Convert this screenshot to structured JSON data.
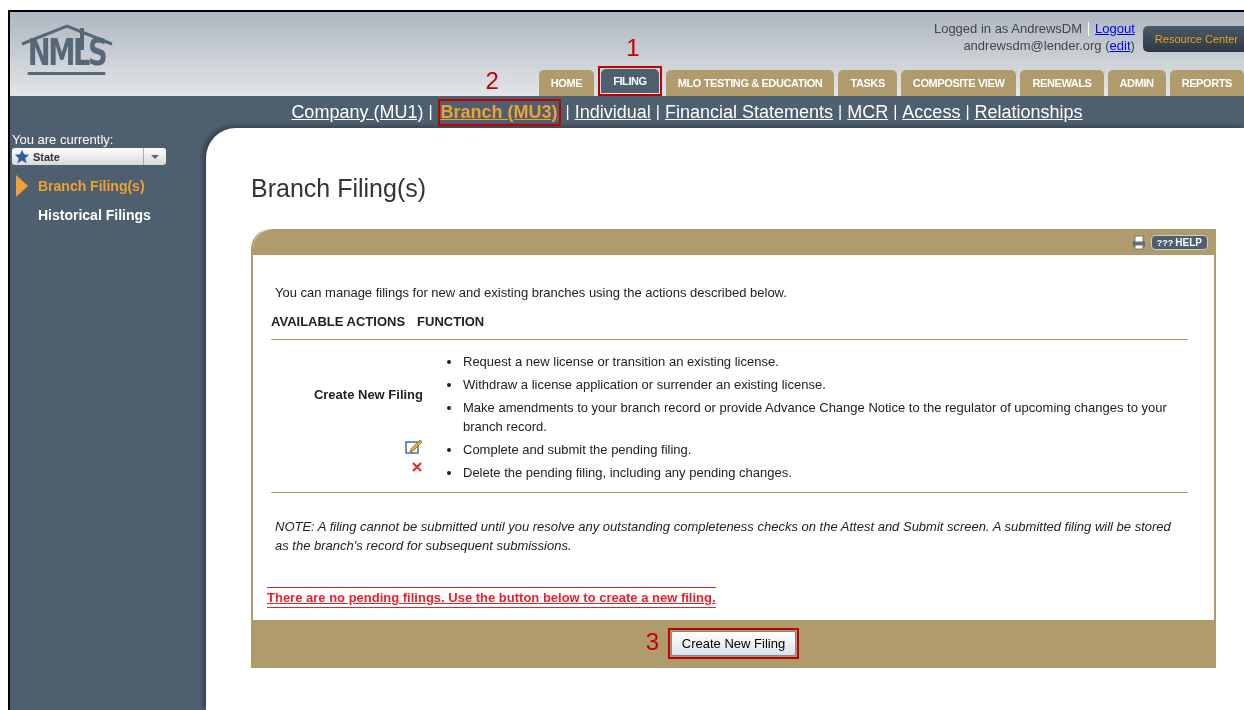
{
  "header": {
    "logo": {
      "text": "NMLS"
    },
    "user": {
      "logged_in": "Logged in as AndrewsDM",
      "logout": "Logout",
      "email_prefix": "andrewsdm@lender.org (",
      "edit": "edit",
      "email_suffix": ")"
    },
    "resource_button": "Resource Center",
    "tabs": [
      {
        "label": "HOME",
        "selected": false
      },
      {
        "label": "FILING",
        "selected": true,
        "callout": "1"
      },
      {
        "label": "MLO TESTING & EDUCATION",
        "selected": false
      },
      {
        "label": "TASKS",
        "selected": false
      },
      {
        "label": "COMPOSITE VIEW",
        "selected": false
      },
      {
        "label": "RENEWALS",
        "selected": false
      },
      {
        "label": "ADMIN",
        "selected": false
      },
      {
        "label": "REPORTS",
        "selected": false
      }
    ]
  },
  "subnav": {
    "links": [
      {
        "label": "Company (MU1)",
        "selected": false
      },
      {
        "label": "Branch (MU3)",
        "selected": true,
        "callout": "2"
      },
      {
        "label": "Individual",
        "selected": false
      },
      {
        "label": "Financial Statements",
        "selected": false
      },
      {
        "label": "MCR",
        "selected": false
      },
      {
        "label": "Access",
        "selected": false
      },
      {
        "label": "Relationships",
        "selected": false
      }
    ],
    "separators": [
      "|",
      "|",
      "|",
      "|",
      "|",
      "|"
    ]
  },
  "sidebar": {
    "context_label": "You are currently:",
    "context_select": "State",
    "items": [
      {
        "label": "Branch Filing(s)",
        "selected": true
      },
      {
        "label": "Historical Filings",
        "selected": false
      }
    ]
  },
  "page_title": "Branch Filing(s)",
  "panel": {
    "help_button": {
      "glyph": "???",
      "label": "HELP"
    },
    "intro": "You can manage filings for new and existing branches using the actions described below.",
    "columns": [
      "AVAILABLE ACTIONS",
      "FUNCTION"
    ],
    "rows": [
      {
        "kind": "text",
        "action": "Create New Filing",
        "functions": [
          "Request a new license or transition an existing license.",
          "Withdraw a license application or surrender an existing license.",
          "Make amendments to your branch record or provide Advance Change Notice to the regulator of upcoming changes to your branch record."
        ]
      },
      {
        "kind": "edit",
        "functions": [
          "Complete and submit the pending filing."
        ]
      },
      {
        "kind": "delete",
        "functions": [
          "Delete the pending filing, including any pending changes."
        ]
      }
    ],
    "note": "NOTE: A filing cannot be submitted until you resolve any outstanding completeness checks on the Attest and Submit screen. A submitted filing will be stored as the branch's record for subsequent submissions.",
    "message": "There are no pending filings. Use the button below to create a new filing.",
    "button": {
      "label": "Create New Filing",
      "callout": "3"
    }
  }
}
